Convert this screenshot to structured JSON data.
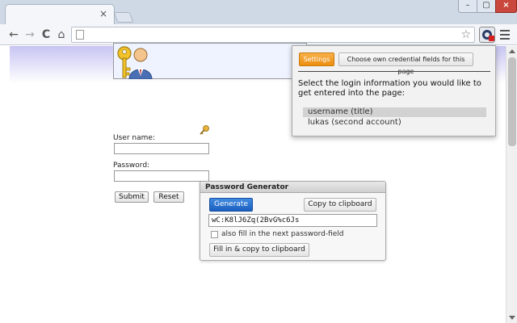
{
  "browser": {
    "tab_close": "×",
    "window_controls": {
      "minimize": "–",
      "maximize": "▢",
      "close": "×"
    },
    "nav": {
      "back": "←",
      "forward": "→",
      "reload": "C",
      "home": "⌂"
    },
    "bookmark_star": "☆",
    "omnibox_value": ""
  },
  "login_form": {
    "username_label": "User name:",
    "password_label": "Password:",
    "username_value": "",
    "password_value": "",
    "submit_label": "Submit",
    "reset_label": "Reset"
  },
  "popup": {
    "settings_label": "Settings",
    "own_fields_label": "Choose own credential fields for this page",
    "instruction": "Select the login information you would like to get entered into the page:",
    "credentials": [
      {
        "label": "username (title)",
        "selected": true
      },
      {
        "label": "lukas (second account)",
        "selected": false
      }
    ]
  },
  "password_generator": {
    "title": "Password Generator",
    "generate_label": "Generate",
    "copy_label": "Copy to clipboard",
    "generated_password": "wC:K8lJ6Zq(2BvG%c6Js",
    "checkbox_label": "also fill in the next password-field",
    "checkbox_checked": false,
    "fill_copy_label": "Fill in & copy to clipboard"
  },
  "colors": {
    "settings_button": "#eb8e10",
    "generate_button": "#1b5fbf",
    "banner_gradient_top": "#c7c4f2"
  }
}
